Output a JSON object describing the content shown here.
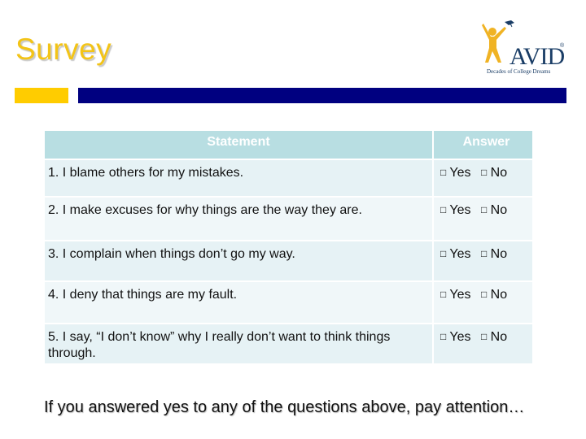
{
  "slide": {
    "title": "Survey",
    "colors": {
      "title": "#f3c417",
      "accent_yellow": "#ffcc00",
      "accent_navy": "#000080",
      "header_bg": "#b8dee2",
      "row_bg": "#e6f2f5"
    }
  },
  "logo": {
    "icon": "avid-figure-graduation-cap-icon",
    "wordmark": "AVID",
    "registered": "®",
    "tagline": "Decades of College Dreams"
  },
  "table": {
    "headers": [
      "Statement",
      "Answer"
    ],
    "checkbox_glyph": "□",
    "rows": [
      {
        "statement": "1.  I blame others for my mistakes.",
        "options": [
          "Yes",
          "No"
        ]
      },
      {
        "statement": "2.  I make excuses for why things are the way they are.",
        "options": [
          "Yes",
          "No"
        ]
      },
      {
        "statement": "3.  I complain when things don’t go my way.",
        "options": [
          "Yes",
          "No"
        ]
      },
      {
        "statement": "4.  I deny that things are my fault.",
        "options": [
          "Yes",
          "No"
        ]
      },
      {
        "statement": "5.  I say, “I don’t know” why I really don’t want to think things through.",
        "options": [
          "Yes",
          "No"
        ]
      }
    ]
  },
  "footer": {
    "text": "If you answered yes to any of the questions above, pay attention…"
  }
}
